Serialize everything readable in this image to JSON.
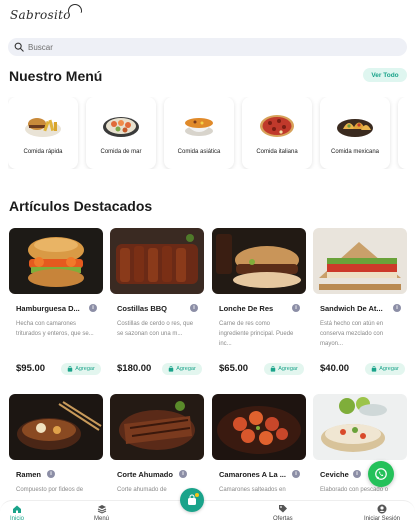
{
  "brand": {
    "logo_text": "Sabrosito"
  },
  "search": {
    "placeholder": "Buscar"
  },
  "menu_section": {
    "title": "Nuestro Menú",
    "see_all": "Ver Todo"
  },
  "categories": [
    {
      "label": "Comida rápida",
      "icon": "burger-plate-icon"
    },
    {
      "label": "Comida de mar",
      "icon": "seafood-plate-icon"
    },
    {
      "label": "Comida asiática",
      "icon": "soup-bowl-icon"
    },
    {
      "label": "Comida italiana",
      "icon": "pizza-icon"
    },
    {
      "label": "Comida mexicana",
      "icon": "taco-plate-icon"
    }
  ],
  "featured": {
    "title": "Artículos Destacados",
    "add_label": "Agregar",
    "items": [
      {
        "name": "Hamburguesa D...",
        "desc": "Hecha con camarones triturados y enteros, que se...",
        "price": "$95.00"
      },
      {
        "name": "Costillas BBQ",
        "desc": "Costillas de cerdo o res, que se sazonan con una m...",
        "price": "$180.00"
      },
      {
        "name": "Lonche De Res",
        "desc": "Carne de res como ingrediente principal. Puede inc...",
        "price": "$65.00"
      },
      {
        "name": "Sandwich De At...",
        "desc": "Está hecho con atún en conserva mezclado con mayon...",
        "price": "$40.00"
      },
      {
        "name": "Ramen",
        "desc": "Compuesto por fideos de",
        "price": ""
      },
      {
        "name": "Corte Ahumado",
        "desc": "Corte ahumado de",
        "price": ""
      },
      {
        "name": "Camarones A La ...",
        "desc": "Camarones salteados en",
        "price": ""
      },
      {
        "name": "Ceviche",
        "desc": "Elaborado con pescado o",
        "price": ""
      }
    ]
  },
  "nav": {
    "home": "Inicio",
    "menu": "Menú",
    "offers": "Ofertas",
    "login": "Iniciar Sesión"
  },
  "colors": {
    "accent": "#1aa38a",
    "whatsapp": "#25c15a"
  }
}
